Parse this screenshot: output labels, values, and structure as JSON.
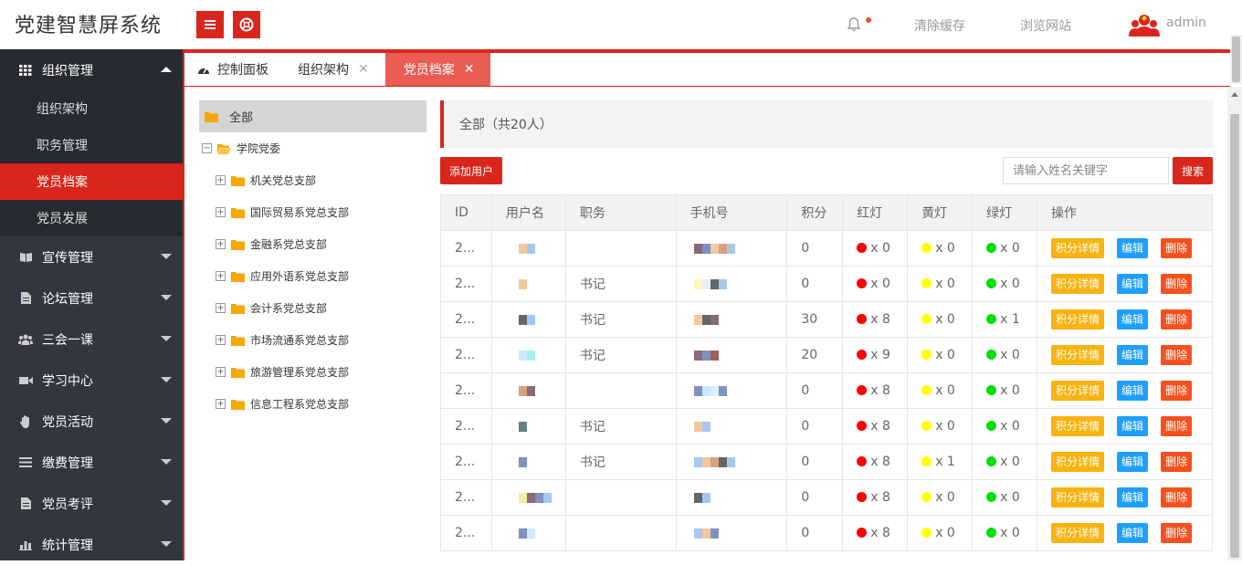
{
  "app": {
    "title": "党建智慧屏系统"
  },
  "header": {
    "clear_cache": "清除缓存",
    "browse_site": "浏览网站",
    "user": "admin"
  },
  "colors": {
    "accent": "#d9261c",
    "sidebar_bg": "#32363f",
    "red": "#ff0000",
    "yellow": "#ffff00",
    "green": "#00e000"
  },
  "sidebar": {
    "groups": [
      {
        "label": "组织管理",
        "icon": "grid-icon"
      },
      {
        "label": "宣传管理",
        "icon": "book-icon"
      },
      {
        "label": "论坛管理",
        "icon": "document-icon"
      },
      {
        "label": "三会一课",
        "icon": "users-icon"
      },
      {
        "label": "学习中心",
        "icon": "video-icon"
      },
      {
        "label": "党员活动",
        "icon": "hand-icon"
      },
      {
        "label": "缴费管理",
        "icon": "list-icon"
      },
      {
        "label": "党员考评",
        "icon": "document-icon"
      },
      {
        "label": "统计管理",
        "icon": "chart-icon"
      }
    ],
    "subitems": [
      "组织架构",
      "职务管理",
      "党员档案",
      "党员发展"
    ]
  },
  "tabs": [
    "控制面板",
    "组织架构",
    "党员档案"
  ],
  "tree": {
    "root": "全部",
    "parent": "学院党委",
    "children": [
      "机关党总支部",
      "国际贸易系党总支部",
      "金融系党总支部",
      "应用外语系党总支部",
      "会计系党总支部",
      "市场流通系党总支部",
      "旅游管理系党总支部",
      "信息工程系党总支部"
    ]
  },
  "content": {
    "breadcrumb": "全部（共20人）",
    "add_button": "添加用户",
    "search_placeholder": "请输入姓名关键字",
    "search_button": "搜索"
  },
  "table": {
    "headers": [
      "ID",
      "用户名",
      "职务",
      "手机号",
      "积分",
      "红灯",
      "黄灯",
      "绿灯",
      "操作"
    ],
    "actions": {
      "score": "积分详情",
      "edit": "编辑",
      "delete": "删除"
    },
    "rows": [
      {
        "id": "2...",
        "duty": "",
        "points": "0",
        "red": "x 0",
        "yellow": "x 0",
        "green": "x 0"
      },
      {
        "id": "2...",
        "duty": "书记",
        "points": "0",
        "red": "x 0",
        "yellow": "x 0",
        "green": "x 0"
      },
      {
        "id": "2...",
        "duty": "书记",
        "points": "30",
        "red": "x 8",
        "yellow": "x 0",
        "green": "x 1"
      },
      {
        "id": "2...",
        "duty": "书记",
        "points": "20",
        "red": "x 9",
        "yellow": "x 0",
        "green": "x 0"
      },
      {
        "id": "2...",
        "duty": "",
        "points": "0",
        "red": "x 8",
        "yellow": "x 0",
        "green": "x 0"
      },
      {
        "id": "2...",
        "duty": "书记",
        "points": "0",
        "red": "x 8",
        "yellow": "x 0",
        "green": "x 0"
      },
      {
        "id": "2...",
        "duty": "书记",
        "points": "0",
        "red": "x 8",
        "yellow": "x 1",
        "green": "x 0"
      },
      {
        "id": "2...",
        "duty": "",
        "points": "0",
        "red": "x 8",
        "yellow": "x 0",
        "green": "x 0"
      },
      {
        "id": "2...",
        "duty": "",
        "points": "0",
        "red": "x 8",
        "yellow": "x 0",
        "green": "x 0"
      }
    ]
  }
}
